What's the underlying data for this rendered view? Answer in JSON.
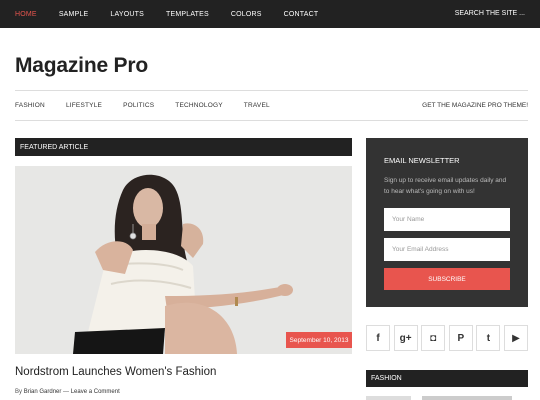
{
  "topnav": {
    "items": [
      {
        "label": "HOME",
        "active": true
      },
      {
        "label": "SAMPLE"
      },
      {
        "label": "LAYOUTS"
      },
      {
        "label": "TEMPLATES"
      },
      {
        "label": "COLORS"
      },
      {
        "label": "CONTACT"
      }
    ],
    "search_label": "SEARCH THE SITE ..."
  },
  "site": {
    "title": "Magazine Pro"
  },
  "secnav": {
    "items": [
      "FASHION",
      "LIFESTYLE",
      "POLITICS",
      "TECHNOLOGY",
      "TRAVEL"
    ],
    "cta": "GET THE MAGAZINE PRO THEME!"
  },
  "featured": {
    "heading": "FEATURED ARTICLE",
    "date": "September 10, 2013",
    "title": "Nordstrom Launches Women's Fashion",
    "by": "By",
    "author": "Brian Gardner",
    "separator": "—",
    "comment_link": "Leave a Comment"
  },
  "newsletter": {
    "title": "EMAIL NEWSLETTER",
    "text": "Sign up to receive email updates daily and to hear what's going on with us!",
    "name_placeholder": "Your Name",
    "email_placeholder": "Your Email Address",
    "subscribe_label": "SUBSCRIBE"
  },
  "socials": [
    {
      "icon": "facebook-icon",
      "glyph": "f"
    },
    {
      "icon": "google-plus-icon",
      "glyph": "g+"
    },
    {
      "icon": "instagram-icon",
      "glyph": "◘"
    },
    {
      "icon": "pinterest-icon",
      "glyph": "P"
    },
    {
      "icon": "twitter-icon",
      "glyph": "t"
    },
    {
      "icon": "youtube-icon",
      "glyph": "▶"
    }
  ],
  "sidebar_section": {
    "heading": "FASHION"
  },
  "colors": {
    "accent": "#e8554e",
    "dark": "#222222",
    "panel": "#333333"
  }
}
